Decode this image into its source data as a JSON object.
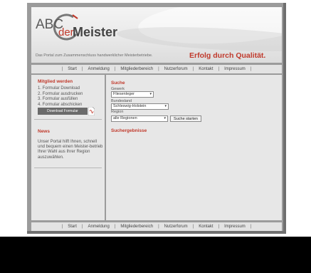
{
  "header": {
    "logo_abc": "ABC",
    "logo_der": "der",
    "logo_meister": "Meister",
    "tagline": "Das Portal zum Zusammenschluss handwerklicher Meisterbetriebe.",
    "slogan": "Erfolg durch Qualität."
  },
  "nav": {
    "items": [
      "Start",
      "Anmeldung",
      "Mitgliederbereich",
      "Nutzerforum",
      "Kontakt",
      "Impressum"
    ],
    "separator": "|"
  },
  "sidebar": {
    "member_title": "Mitglied werden",
    "steps": [
      "1. Formular Download",
      "2. Formular ausdrucken",
      "3. Formular ausfüllen",
      "4. Formular abschicken"
    ],
    "download_button": "Download Formular",
    "news_title": "News",
    "news_text": "Unser Portal hilft Ihnen, schnell und bequem einen Meister-betrieb Ihrer Wahl aus Ihrer Region auszuwählen."
  },
  "search": {
    "title": "Suche",
    "gewerk_label": "Gewerk",
    "gewerk_value": "Fliesenleger",
    "bundesland_label": "Bundesland",
    "bundesland_value": "Schleswig-Holstein",
    "region_label": "Region",
    "region_value": "alle Regionen",
    "button_label": "Suche starten",
    "results_title": "Suchergebnisse"
  },
  "colors": {
    "accent": "#c0392b",
    "frame": "#9b9b9b",
    "panel": "#e7e7e7"
  }
}
